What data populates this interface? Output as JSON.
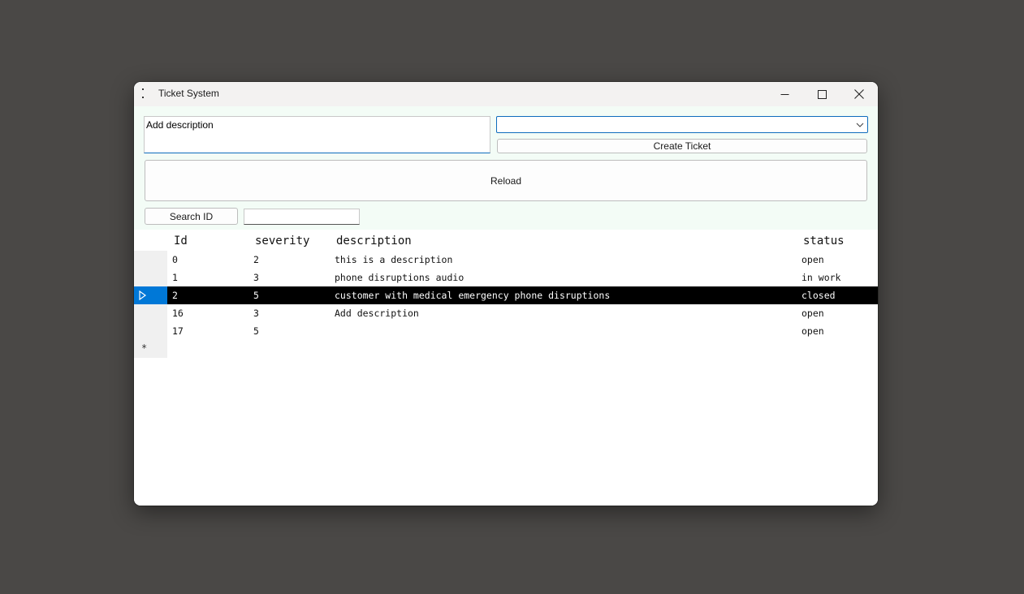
{
  "window": {
    "title": "Ticket System"
  },
  "form": {
    "description_value": "Add description",
    "severity_selected": "",
    "create_label": "Create Ticket",
    "reload_label": "Reload",
    "search_label": "Search ID",
    "search_value": ""
  },
  "grid": {
    "columns": [
      "Id",
      "severity",
      "description",
      "status"
    ],
    "rows": [
      {
        "id": "0",
        "severity": "2",
        "description": "this is a description",
        "status": "open"
      },
      {
        "id": "1",
        "severity": "3",
        "description": "phone disruptions audio",
        "status": "in work"
      },
      {
        "id": "2",
        "severity": "5",
        "description": "customer with medical emergency phone disruptions",
        "status": "closed"
      },
      {
        "id": "16",
        "severity": "3",
        "description": "Add description",
        "status": "open"
      },
      {
        "id": "17",
        "severity": "5",
        "description": "",
        "status": "open"
      }
    ],
    "selected_row_index": 2,
    "new_row_glyph": "*"
  },
  "icons": {
    "app": "app-menu-icon",
    "minimize": "minimize-icon",
    "maximize": "maximize-icon",
    "close": "close-icon",
    "dropdown": "chevron-down-icon",
    "row_selector": "row-pointer-icon"
  },
  "colors": {
    "selection_background": "#000000",
    "selection_indicator": "#0078d7",
    "panel_background": "#f3fcf6",
    "focus_accent": "#0f6cbd"
  }
}
